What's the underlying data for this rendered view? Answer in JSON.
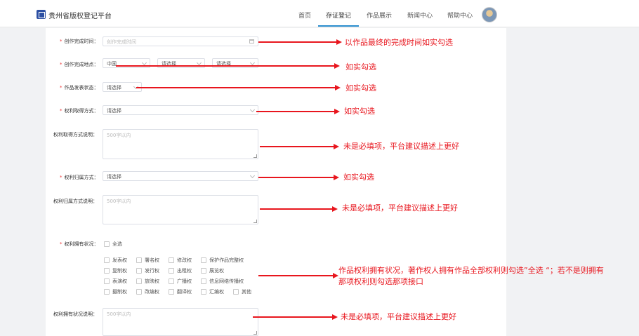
{
  "header": {
    "brand": "贵州省版权登记平台",
    "nav": [
      "首页",
      "存证登记",
      "作品展示",
      "新闻中心",
      "帮助中心"
    ]
  },
  "form": {
    "completion_time": {
      "label": "创作完成时间：",
      "placeholder": "创作完成时间"
    },
    "completion_place": {
      "label": "创作完成地点：",
      "country": "中国",
      "province": "请选择",
      "city": "请选择"
    },
    "publish_status": {
      "label": "作品发表状态：",
      "value": "请选择"
    },
    "acquire_method": {
      "label": "权利取得方式：",
      "value": "请选择"
    },
    "acquire_desc": {
      "label": "权利取得方式说明：",
      "placeholder": "500字以内"
    },
    "ownership_method": {
      "label": "权利归属方式：",
      "value": "请选择"
    },
    "ownership_desc": {
      "label": "权利归属方式说明：",
      "placeholder": "500字以内"
    },
    "rights_status": {
      "label": "权利拥有状况：",
      "select_all": "全选",
      "rows": [
        [
          "发表权",
          "署名权",
          "修改权",
          "保护作品完整权"
        ],
        [
          "复制权",
          "发行权",
          "出租权",
          "展览权"
        ],
        [
          "表演权",
          "放映权",
          "广播权",
          "信息网络传播权"
        ],
        [
          "摄制权",
          "改编权",
          "翻译权",
          "汇编权",
          "其他"
        ]
      ]
    },
    "rights_desc": {
      "label": "权利拥有状况说明：",
      "placeholder": "500字以内"
    }
  },
  "annotations": {
    "n1": "以作品最终的完成时间如实勾选",
    "n2": "如实勾选",
    "n3": "如实勾选",
    "n4": "如实勾选",
    "n5": "未是必填项，平台建议描述上更好",
    "n6": "如实勾选",
    "n7": "未是必填项，平台建议描述上更好",
    "n8a": "作品权利拥有状况，著作权人拥有作品全部权利则勾选”全选 “；若不是则拥有",
    "n8b": "那项权利则勾选那项接口",
    "n9": "未是必填项，平台建议描述上更好"
  },
  "colors": {
    "annotation": "#e8161e",
    "nav_accent": "#2c8fcf",
    "logo": "#2c4fa3"
  }
}
